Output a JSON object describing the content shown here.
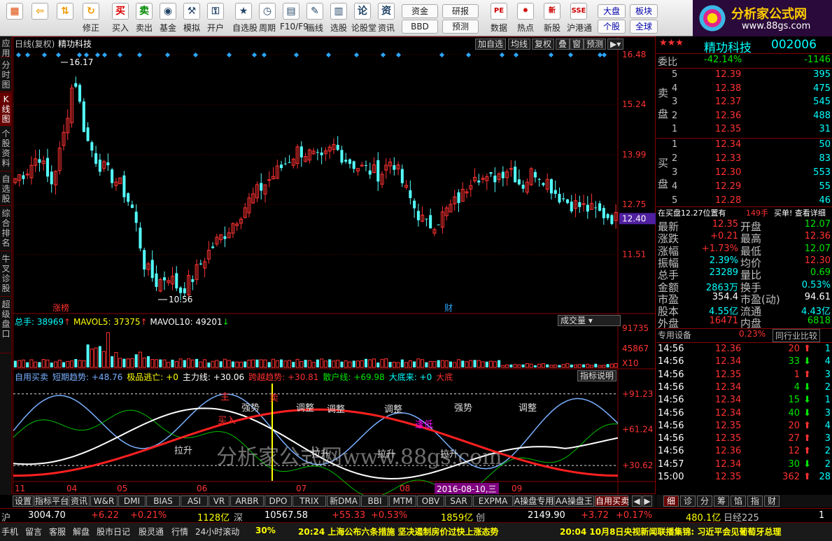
{
  "toolbar": {
    "buttons": [
      {
        "label": "",
        "icon": "windows-icon"
      },
      {
        "label": "",
        "icon": "back-arrow-icon"
      },
      {
        "label": "",
        "icon": "up-down-icon"
      },
      {
        "label": "修正",
        "icon": "refresh-icon"
      },
      {
        "label": "买入",
        "icon": "buy-icon"
      },
      {
        "label": "卖出",
        "icon": "sell-icon"
      },
      {
        "label": "基金",
        "icon": "fund-icon"
      },
      {
        "label": "模拟",
        "icon": "simulate-icon"
      },
      {
        "label": "开户",
        "icon": "lock-icon"
      },
      {
        "label": "自选股",
        "icon": "watchlist-icon"
      },
      {
        "label": "周期",
        "icon": "clock-icon"
      },
      {
        "label": "F10/F9",
        "icon": "f10-icon"
      },
      {
        "label": "画线",
        "icon": "pencil-icon"
      },
      {
        "label": "选股",
        "icon": "bars-icon"
      },
      {
        "label": "论股堂",
        "icon": "forum-icon"
      },
      {
        "label": "资讯",
        "icon": "news-icon"
      }
    ],
    "small": [
      [
        "资金",
        "BBD"
      ],
      [
        "研报",
        "预测"
      ]
    ],
    "right": [
      {
        "label": "数据",
        "icon": "pe-icon"
      },
      {
        "label": "热点",
        "icon": "hot-icon"
      },
      {
        "label": "新股",
        "icon": "newstock-icon"
      },
      {
        "label": "沪港通",
        "icon": "hk-icon"
      }
    ],
    "market": [
      [
        "大盘",
        "个股"
      ],
      [
        "板块",
        "全球"
      ]
    ]
  },
  "logo": {
    "title": "分析家公式网",
    "url": "www.88gs.com"
  },
  "sidetabs": [
    "应用",
    "分时图",
    "K线图",
    "个股资料",
    "自选股",
    "综合排名",
    "牛叉诊股",
    "超级盘口"
  ],
  "chart": {
    "period": "日线(复权)",
    "stock": "精功科技",
    "buttons": [
      "加自选",
      "均线",
      "复权",
      "叠",
      "窗",
      "预测"
    ],
    "price_axis": [
      "16.48",
      "15.24",
      "13.99",
      "12.75",
      "11.51"
    ],
    "current_price_tag": "12.40",
    "high_label": "16.17",
    "low_label": "10.56",
    "events": [
      "涨榜",
      "财"
    ],
    "volume": {
      "total_label": "总手: 38969",
      "ma5": "MAVOL5: 37375",
      "ma10": "MAVOL10: 49201",
      "dropdown": "成交量",
      "axis": [
        "91735",
        "45867"
      ],
      "unit": "X10"
    },
    "indicator": {
      "name": "自用买卖",
      "items": [
        {
          "label": "短期趋势: +48.76",
          "color": "#7ab0ff"
        },
        {
          "label": "极品逃亡: +0",
          "color": "#ffff00"
        },
        {
          "label": "主力线: +30.06",
          "color": "#ffffff"
        },
        {
          "label": "跨越趋势: +30.81",
          "color": "#ff3030"
        },
        {
          "label": "散户线: +69.98",
          "color": "#00e600"
        },
        {
          "label": "大底来: +0",
          "color": "#00ffff"
        },
        {
          "label": "大底",
          "color": "#ff3030"
        }
      ],
      "button": "指标说明",
      "axis": [
        "+91.23",
        "+61.24",
        "+30.62"
      ],
      "annotations": [
        "拉升",
        "主",
        "买入",
        "强势",
        "卖",
        "调整",
        "调整",
        "拉升",
        "调整",
        "拉升",
        "逢低",
        "拉升",
        "强势",
        "调整"
      ]
    },
    "watermark": "分析家公式网www.88gs.com",
    "date_axis": [
      "11",
      "04",
      "05",
      "06",
      "07",
      "08",
      "09"
    ],
    "date_tag": "2016-08-10,三"
  },
  "quote": {
    "stars": "★★★",
    "name": "精功科技",
    "code": "002006",
    "weibi": {
      "label": "委比",
      "pct": "-42.14%",
      "val": "-1146"
    },
    "sell": [
      {
        "lvl": "5",
        "price": "12.39",
        "vol": "395"
      },
      {
        "lvl": "4",
        "price": "12.38",
        "vol": "475"
      },
      {
        "lvl": "3",
        "price": "12.37",
        "vol": "545"
      },
      {
        "lvl": "2",
        "price": "12.36",
        "vol": "488"
      },
      {
        "lvl": "1",
        "price": "12.35",
        "vol": "31"
      }
    ],
    "buy": [
      {
        "lvl": "1",
        "price": "12.34",
        "vol": "50"
      },
      {
        "lvl": "2",
        "price": "12.33",
        "vol": "83"
      },
      {
        "lvl": "3",
        "price": "12.30",
        "vol": "553"
      },
      {
        "lvl": "4",
        "price": "12.29",
        "vol": "55"
      },
      {
        "lvl": "5",
        "price": "12.28",
        "vol": "46"
      }
    ],
    "sell_label": "卖盘",
    "buy_label": "买盘",
    "notice": {
      "text": "在买盘12.27位置有",
      "qty": "149手",
      "tail": "买单! 查看详细"
    },
    "stats": [
      [
        "最新",
        "12.35",
        "red",
        "开盘",
        "12.07",
        "green"
      ],
      [
        "涨跌",
        "+0.21",
        "red",
        "最高",
        "12.36",
        "red"
      ],
      [
        "涨幅",
        "+1.73%",
        "red",
        "最低",
        "12.07",
        "green"
      ],
      [
        "振幅",
        "2.39%",
        "cyan",
        "均价",
        "12.30",
        "red"
      ],
      [
        "总手",
        "23289",
        "cyan",
        "量比",
        "0.69",
        "green"
      ],
      [
        "金额",
        "2863万",
        "cyan",
        "换手",
        "0.53%",
        "cyan"
      ],
      [
        "市盈",
        "354.4",
        "white",
        "市盈(动)",
        "94.61",
        "white"
      ],
      [
        "股本",
        "4.55亿",
        "cyan",
        "流通",
        "4.43亿",
        "cyan"
      ],
      [
        "外盘",
        "16471",
        "red",
        "内盘",
        "6818",
        "green"
      ]
    ],
    "tabs": {
      "left": "专用设备",
      "pct": "0.23%",
      "right": "同行业比较"
    },
    "ticks": [
      [
        "14:56",
        "12.36",
        "20",
        "up",
        "1"
      ],
      [
        "14:56",
        "12.34",
        "33",
        "down",
        "4"
      ],
      [
        "14:56",
        "12.35",
        "1",
        "up",
        "3"
      ],
      [
        "14:56",
        "12.34",
        "4",
        "down",
        "2"
      ],
      [
        "14:56",
        "12.34",
        "15",
        "down",
        "1"
      ],
      [
        "14:56",
        "12.34",
        "40",
        "down",
        "3"
      ],
      [
        "14:56",
        "12.35",
        "20",
        "up",
        "4"
      ],
      [
        "14:56",
        "12.35",
        "27",
        "up",
        "3"
      ],
      [
        "14:56",
        "12.36",
        "12",
        "up",
        "2"
      ],
      [
        "14:57",
        "12.34",
        "30",
        "down",
        "2"
      ],
      [
        "15:00",
        "12.35",
        "362",
        "up",
        "28"
      ]
    ]
  },
  "bottomtabs": [
    "设置",
    "指标平台",
    "资讯",
    "W&R",
    "DMI",
    "BIAS",
    "ASI",
    "VR",
    "ARBR",
    "DPO",
    "TRIX",
    "新DMA",
    "BBI",
    "MTM",
    "OBV",
    "SAR",
    "EXPMA",
    "A操盘专用",
    "AA操盘王",
    "自用买卖"
  ],
  "righttabs": [
    "细",
    "诊",
    "分",
    "筹",
    "馅",
    "指",
    "财"
  ],
  "status1": {
    "sh_label": "沪",
    "sh_val": "3004.70",
    "sh_chg": "+6.22",
    "sh_pct": "+0.21%",
    "sh_amt": "1128亿",
    "sz_label": "深",
    "sz_val": "10567.58",
    "sz_chg": "+55.33",
    "sz_pct": "+0.53%",
    "sz_amt": "1859亿",
    "cy_label": "创",
    "cy_val": "2149.90",
    "cy_chg": "+3.72",
    "cy_pct": "+0.17%",
    "cy_amt": "480.1亿",
    "rj_label": "日经225",
    "rj_val": "1"
  },
  "status2": {
    "items": [
      "手机",
      "留言",
      "客服",
      "解盘",
      "股市日记",
      "股灵通",
      "行情",
      "24小时滚动"
    ],
    "pct": "30%",
    "news1": "20:24 上海公布六条措施 坚决遏制房价过快上涨态势",
    "news2": "20:04 10月8日央视新闻联播集锦: 习近平会见葡萄牙总理"
  },
  "colors": {
    "up": "#ff3232",
    "down": "#00e600",
    "candle_down": "#54ffff",
    "accent": "#800000"
  }
}
